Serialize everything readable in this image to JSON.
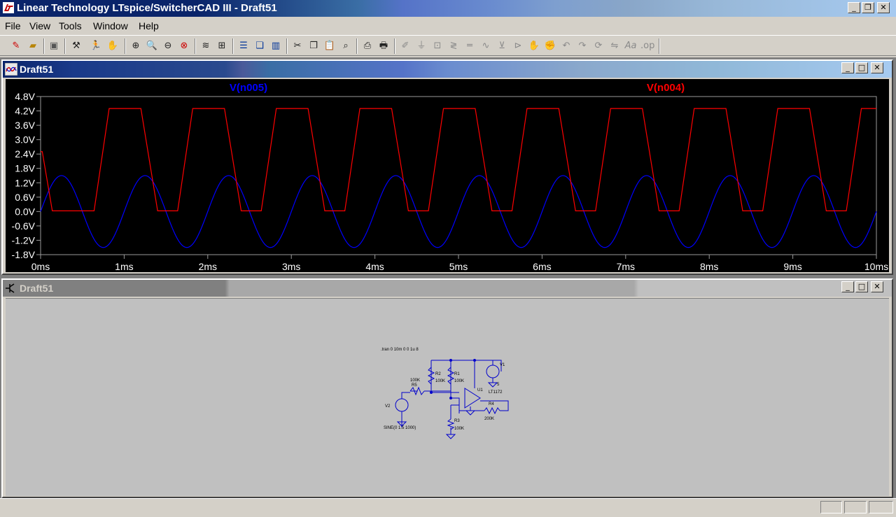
{
  "app": {
    "title": "Linear Technology LTspice/SwitcherCAD III - Draft51",
    "window_buttons": {
      "minimize": "_",
      "restore": "❐",
      "close": "✕"
    }
  },
  "menu": [
    {
      "label": "File"
    },
    {
      "label": "View"
    },
    {
      "label": "Tools"
    },
    {
      "label": "Window"
    },
    {
      "label": "Help"
    }
  ],
  "toolbar": {
    "icons": [
      "new-schematic-icon",
      "open-icon",
      "save-icon",
      "control-panel-icon",
      "run-icon",
      "halt-icon",
      "zoom-in-icon",
      "zoom-pan-icon",
      "zoom-out-icon",
      "zoom-fit-icon",
      "autorange-icon",
      "grid-icon",
      "tile-horizontal-icon",
      "cascade-icon",
      "tile-vertical-icon",
      "cut-icon",
      "copy-icon",
      "paste-icon",
      "find-icon",
      "print-setup-icon",
      "print-icon",
      "wire-icon",
      "ground-icon",
      "label-net-icon",
      "resistor-icon",
      "capacitor-icon",
      "inductor-icon",
      "diode-icon",
      "component-icon",
      "move-icon",
      "drag-icon",
      "undo-icon",
      "redo-icon",
      "rotate-icon",
      "mirror-icon",
      "text-icon",
      "spice-directive-icon"
    ]
  },
  "waveform_window": {
    "title": "Draft51",
    "traces": [
      {
        "label": "V(n005)",
        "color": "#0000ff"
      },
      {
        "label": "V(n004)",
        "color": "#ff0000"
      }
    ]
  },
  "chart_data": {
    "type": "line",
    "xlabel": "",
    "ylabel": "",
    "x_unit": "ms",
    "y_unit": "V",
    "xlim": [
      0,
      10
    ],
    "ylim": [
      -1.8,
      4.8
    ],
    "x_ticks": [
      "0ms",
      "1ms",
      "2ms",
      "3ms",
      "4ms",
      "5ms",
      "6ms",
      "7ms",
      "8ms",
      "9ms",
      "10ms"
    ],
    "y_ticks": [
      "4.8V",
      "4.2V",
      "3.6V",
      "3.0V",
      "2.4V",
      "1.8V",
      "1.2V",
      "0.6V",
      "0.0V",
      "-0.6V",
      "-1.2V",
      "-1.8V"
    ],
    "series": [
      {
        "name": "V(n005)",
        "color": "#0000ff",
        "kind": "sine",
        "amplitude": 1.5,
        "offset": 0,
        "frequency_khz": 1,
        "x": [
          0,
          0.25,
          0.5,
          0.75,
          1.0,
          1.25,
          1.5,
          1.75,
          2.0,
          2.25,
          2.5,
          2.75,
          3.0,
          3.25,
          3.5,
          3.75,
          4.0,
          4.25,
          4.5,
          4.75,
          5.0,
          5.25,
          5.5,
          5.75,
          6.0,
          6.25,
          6.5,
          6.75,
          7.0,
          7.25,
          7.5,
          7.75,
          8.0,
          8.25,
          8.5,
          8.75,
          9.0,
          9.25,
          9.5,
          9.75,
          10.0
        ],
        "y": [
          0,
          1.5,
          0,
          -1.5,
          0,
          1.5,
          0,
          -1.5,
          0,
          1.5,
          0,
          -1.5,
          0,
          1.5,
          0,
          -1.5,
          0,
          1.5,
          0,
          -1.5,
          0,
          1.5,
          0,
          -1.5,
          0,
          1.5,
          0,
          -1.5,
          0,
          1.5,
          0,
          -1.5,
          0,
          1.5,
          0,
          -1.5,
          0,
          1.5,
          0,
          -1.5,
          0
        ]
      },
      {
        "name": "V(n004)",
        "color": "#ff0000",
        "kind": "clipped-square",
        "high": 4.3,
        "low": 0.03,
        "x": [
          0,
          0.02,
          0.14,
          0.64,
          0.82,
          0.95,
          1.2,
          1.4,
          1.64,
          1.82,
          1.95,
          2.2,
          2.4,
          2.64,
          2.82,
          2.95,
          3.2,
          3.4,
          3.64,
          3.82,
          3.95,
          4.2,
          4.4,
          4.64,
          4.82,
          4.95,
          5.2,
          5.4,
          5.64,
          5.82,
          5.95,
          6.2,
          6.4,
          6.64,
          6.82,
          6.95,
          7.2,
          7.4,
          7.64,
          7.82,
          7.95,
          8.2,
          8.4,
          8.64,
          8.82,
          8.95,
          9.2,
          9.4,
          9.64,
          9.82,
          9.95,
          10.0
        ],
        "y": [
          2.5,
          2.5,
          0.03,
          0.03,
          4.3,
          4.3,
          4.3,
          0.03,
          0.03,
          4.3,
          4.3,
          4.3,
          0.03,
          0.03,
          4.3,
          4.3,
          4.3,
          0.03,
          0.03,
          4.3,
          4.3,
          4.3,
          0.03,
          0.03,
          4.3,
          4.3,
          4.3,
          0.03,
          0.03,
          4.3,
          4.3,
          4.3,
          0.03,
          0.03,
          4.3,
          4.3,
          4.3,
          0.03,
          0.03,
          4.3,
          4.3,
          4.3,
          0.03,
          0.03,
          4.3,
          4.3,
          4.3,
          0.03,
          0.03,
          4.3,
          4.3,
          4.3
        ]
      }
    ],
    "grid": false,
    "legend": "top"
  },
  "schematic_window": {
    "title": "Draft51",
    "labels": {
      "directive": ".tran 0 10m 0 0 1u 8",
      "v1": "V1",
      "v1_value": "5",
      "v2": "V2",
      "v2_value": "SINE(0 1.5 1000)",
      "r1": "R1",
      "r1_value": "100K",
      "r2": "R2",
      "r2_value": "100K",
      "r3": "R3",
      "r3_value": "100K",
      "r4": "R4",
      "r4_value": "200K",
      "r5": "R5",
      "r5_value": "100K",
      "u1": "U1",
      "u1_value": "LT1172"
    }
  }
}
